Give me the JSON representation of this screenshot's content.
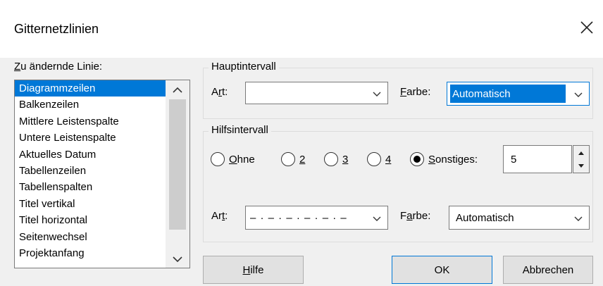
{
  "dialog": {
    "title": "Gitternetzlinien"
  },
  "line_list": {
    "label_mnemonic": "Z",
    "label_rest": "u ändernde Linie:",
    "items": [
      "Diagrammzeilen",
      "Balkenzeilen",
      "Mittlere Leistenspalte",
      "Untere Leistenspalte",
      "Aktuelles Datum",
      "Tabellenzeilen",
      "Tabellenspalten",
      "Titel vertikal",
      "Titel horizontal",
      "Seitenwechsel",
      "Projektanfang"
    ],
    "selected": "Diagrammzeilen"
  },
  "haupt": {
    "group_label": "Hauptintervall",
    "art_label_pre": "A",
    "art_label_mnemonic": "r",
    "art_label_post": "t:",
    "art_value": "",
    "farbe_label_mnemonic": "F",
    "farbe_label_rest": "arbe:",
    "farbe_value": "Automatisch"
  },
  "hilfs": {
    "group_label": "Hilfsintervall",
    "options": [
      {
        "mnemonic": "O",
        "rest": "hne",
        "checked": false
      },
      {
        "mnemonic": "2",
        "rest": "",
        "checked": false
      },
      {
        "mnemonic": "3",
        "rest": "",
        "checked": false
      },
      {
        "mnemonic": "4",
        "rest": "",
        "checked": false
      },
      {
        "mnemonic": "S",
        "rest": "onstiges:",
        "checked": true
      }
    ],
    "sonstiges_value": "5",
    "art_label_pre": "Ar",
    "art_label_mnemonic": "t",
    "art_label_post": ":",
    "art_value": "– · – · – · – · – · –",
    "farbe_label_pre": "F",
    "farbe_label_mnemonic": "a",
    "farbe_label_post": "rbe:",
    "farbe_value": "Automatisch"
  },
  "buttons": {
    "help_mnemonic": "H",
    "help_rest": "ilfe",
    "ok": "OK",
    "cancel": "Abbrechen"
  }
}
